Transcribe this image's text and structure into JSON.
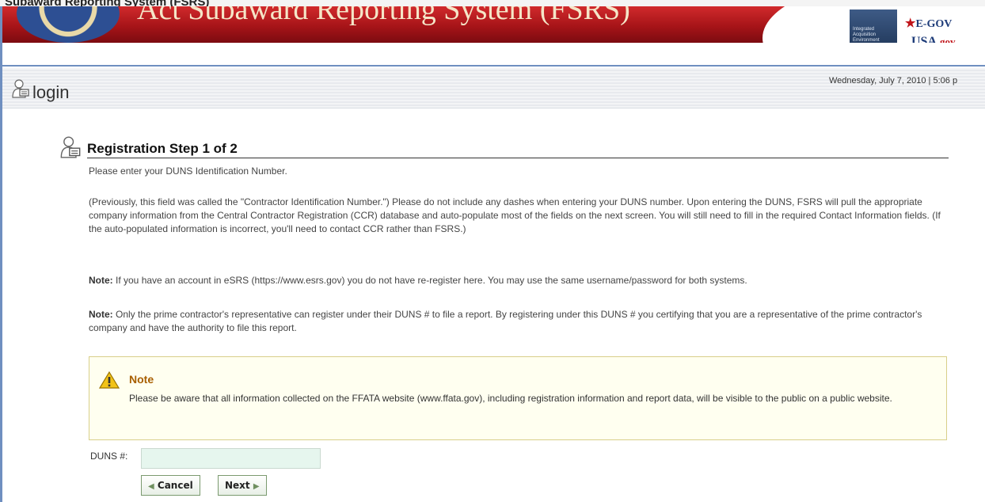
{
  "header": {
    "top_cap_text": "Subaward Reporting System (FSRS)",
    "banner_title": "Act Subaward Reporting System (FSRS)",
    "iae_label": "Integrated Acquisition Environment",
    "egov_label": "E-GOV",
    "usagov_label_main": "USA.",
    "usagov_label_gov": "gov"
  },
  "login_bar": {
    "title": "login",
    "datetime": "Wednesday, July 7, 2010 | 5:06 p"
  },
  "registration": {
    "title": "Registration Step 1 of 2",
    "intro": "Please enter your DUNS Identification Number.",
    "paragraph": "(Previously, this field was called the \"Contractor Identification Number.\") Please do not include any dashes when entering your DUNS number. Upon entering the DUNS, FSRS will pull the appropriate company information from the Central Contractor Registration (CCR) database and auto-populate most of the fields on the next screen. You will still need to fill in the required Contact Information fields. (If the auto-populated information is incorrect, you'll need to contact CCR rather than FSRS.)",
    "note1_label": "Note:",
    "note1_text": " If you have an account in eSRS (https://www.esrs.gov) you do not have re-register here. You may use the same username/password for both systems.",
    "note2_label": "Note:",
    "note2_text": " Only the prime contractor's representative can register under their DUNS # to file a report. By registering under this DUNS # you certifying that you are a representative of the prime contractor's company and have the authority to file this report."
  },
  "notice": {
    "title": "Note",
    "text": "Please be aware that all information collected on the FFATA website (www.ffata.gov), including registration information and report data, will be visible to the public on a public website."
  },
  "form": {
    "duns_label": "DUNS #:",
    "duns_value": "",
    "duns_placeholder": "",
    "cancel_label": "Cancel",
    "next_label": "Next"
  },
  "colors": {
    "banner_red": "#a61418",
    "frame_blue": "#6f8fc0",
    "note_title": "#a85f00",
    "input_bg": "#e6f6ee"
  }
}
